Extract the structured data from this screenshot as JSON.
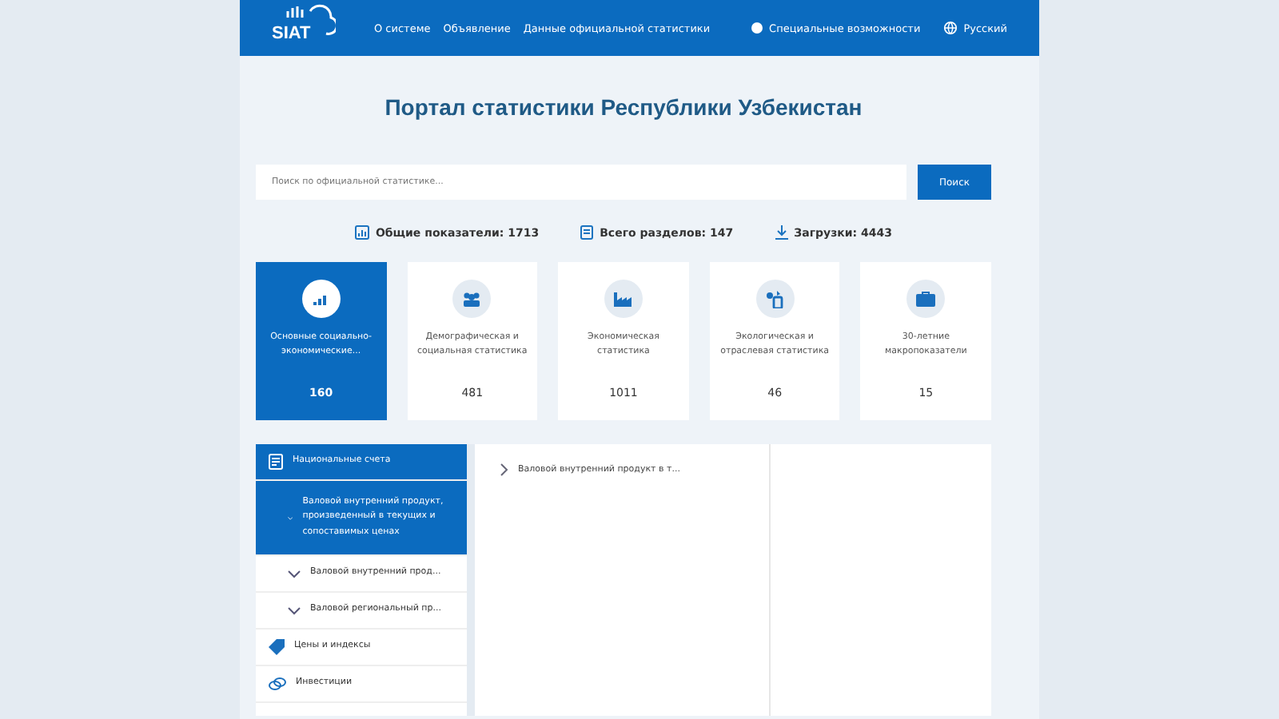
{
  "header": {
    "logo": "SIAT",
    "nav": [
      "О системе",
      "Объявление",
      "Данные официальной статистики"
    ],
    "accessibility": "Специальные возможности",
    "language": "Русский"
  },
  "title": "Портал статистики Республики Узбекистан",
  "search": {
    "placeholder": "Поиск по официальной статистике...",
    "button": "Поиск"
  },
  "stats": [
    {
      "kind": "chart",
      "text": "Общие показатели: 1713"
    },
    {
      "kind": "book",
      "text": "Всего разделов: 147"
    },
    {
      "kind": "download",
      "text": "Загрузки: 4443"
    }
  ],
  "categories": [
    {
      "kind": "chart",
      "label": "Основные социально-экономические...",
      "count": "160",
      "selected": true
    },
    {
      "kind": "people",
      "label": "Демографическая и социальная статистика",
      "count": "481",
      "selected": false
    },
    {
      "kind": "factory",
      "label": "Экономическая статистика",
      "count": "1011",
      "selected": false
    },
    {
      "kind": "eco",
      "label": "Экологическая и отраслевая статистика",
      "count": "46",
      "selected": false
    },
    {
      "kind": "case",
      "label": "30-летние макропоказатели",
      "count": "15",
      "selected": false
    }
  ],
  "tree": [
    {
      "kind": "accounts",
      "label": "Национальные счета",
      "selected": true,
      "children": [
        {
          "label": "Валовой внутренний продукт, произведенный в текущих и сопоставимых ценах",
          "selected": true,
          "expanded": true
        },
        {
          "label": "Валовой внутренний прод...",
          "selected": false,
          "expanded": true
        },
        {
          "label": "Валовой региональный пр...",
          "selected": false,
          "expanded": true
        }
      ]
    },
    {
      "kind": "tag",
      "label": "Цены и индексы",
      "selected": false
    },
    {
      "kind": "invest",
      "label": "Инвестиции",
      "selected": false
    }
  ],
  "results": [
    {
      "label": "Валовой внутренний продукт в т..."
    }
  ]
}
